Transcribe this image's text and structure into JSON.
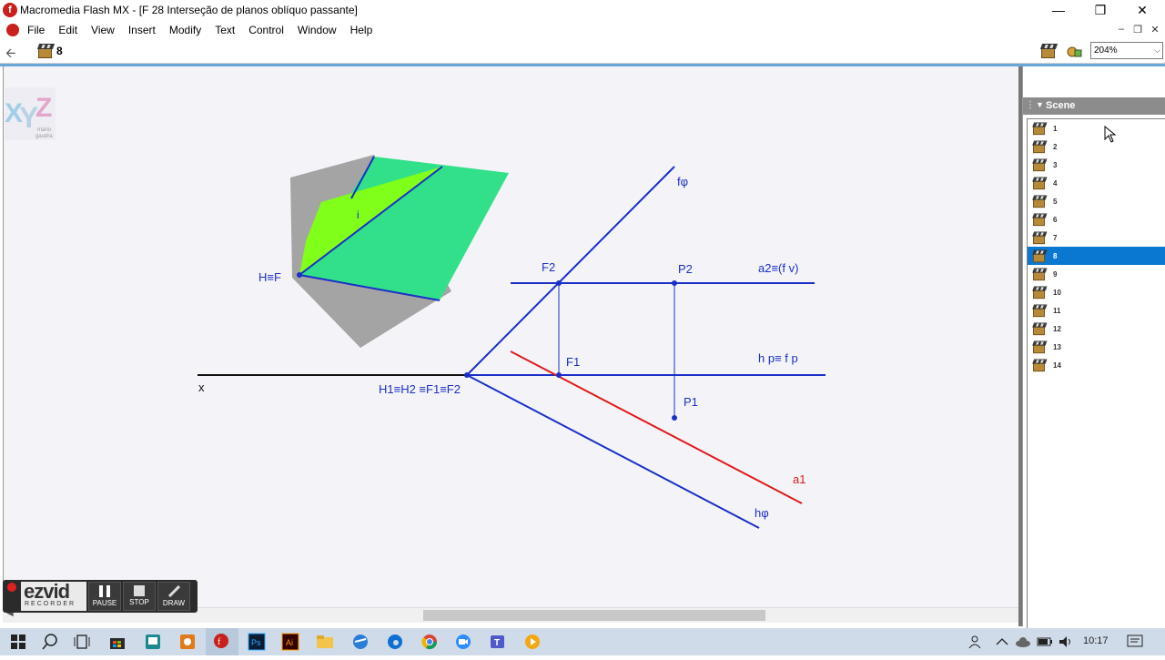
{
  "window": {
    "title": "Macromedia Flash MX - [F 28 Interseção de planos oblíquo passante]",
    "minimize_icon": "minimize-icon",
    "maximize_icon": "restore-icon",
    "close_icon": "close-icon"
  },
  "menu": {
    "items": [
      "File",
      "Edit",
      "View",
      "Insert",
      "Modify",
      "Text",
      "Control",
      "Window",
      "Help"
    ]
  },
  "editbar": {
    "scene_label": "8",
    "zoom_value": "204%"
  },
  "stage": {
    "labels": {
      "f_phi": "fφ",
      "F2": "F2",
      "P2": "P2",
      "a2_fv": "a2≡(f  v)",
      "F1": "F1",
      "hp_fp": "h p≡  f p",
      "x": "x",
      "H1H2": "H1≡H2 ≡F1≡F2",
      "P1": "P1",
      "a1": "a1",
      "h_phi": "hφ",
      "HF": "H≡F",
      "i": "i"
    },
    "colors": {
      "blue": "#1a2fc8",
      "red": "#e01a1a",
      "black": "#111111",
      "gray_plane": "#a0a0a0",
      "green_plane": "#33e08a",
      "lime_plane": "#80ff1a"
    }
  },
  "logo_text": [
    "X",
    "Y",
    "Z",
    "mário",
    "gaudra"
  ],
  "ezvid": {
    "brand": "ezvid",
    "subtitle": "RECORDER",
    "pause": "PAUSE",
    "stop": "STOP",
    "draw": "DRAW"
  },
  "scene_panel": {
    "title": "Scene",
    "items": [
      "1",
      "2",
      "3",
      "4",
      "5",
      "6",
      "7",
      "8",
      "9",
      "10",
      "11",
      "12",
      "13",
      "14"
    ],
    "selected": "8"
  },
  "taskbar": {
    "clock": "10:17",
    "icons": [
      "windows-start-icon",
      "search-icon",
      "task-view-icon",
      "store-icon",
      "app-icon",
      "office-icon",
      "flash-icon",
      "photoshop-icon",
      "illustrator-icon",
      "file-explorer-icon",
      "app-icon-2",
      "edge-icon",
      "chrome-icon",
      "zoom-icon",
      "teams-icon",
      "media-icon"
    ],
    "photoshop_label": "Ps",
    "illustrator_label": "Ai",
    "teams_label": "T"
  }
}
